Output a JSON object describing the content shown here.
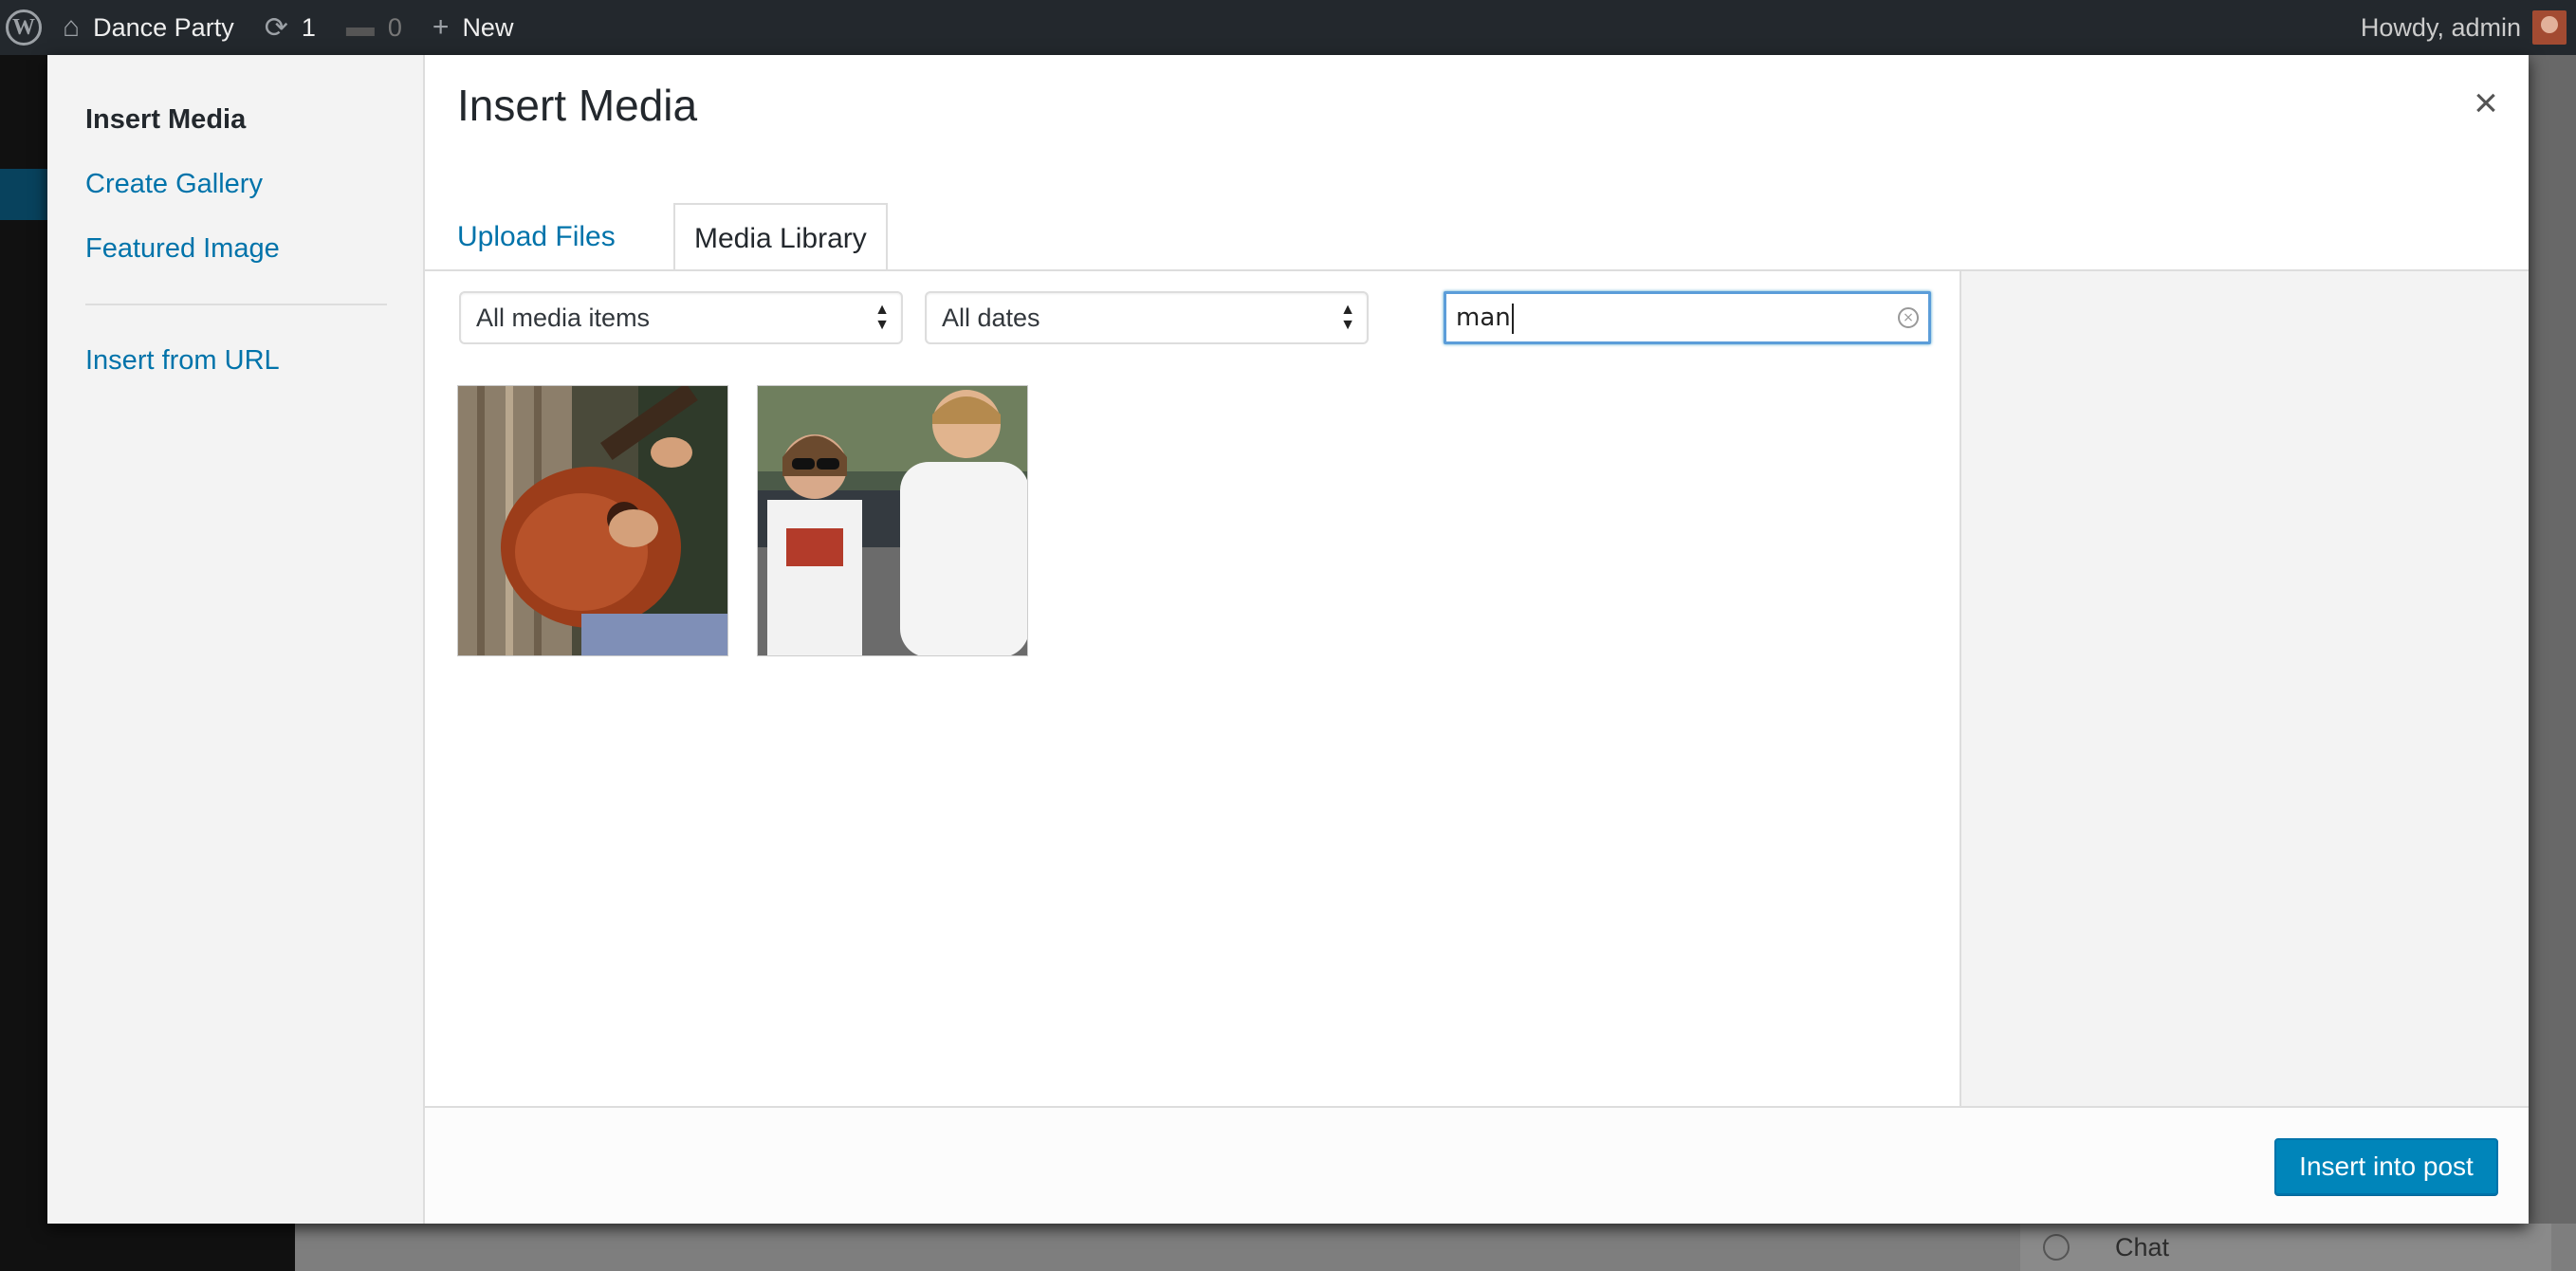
{
  "admin_bar": {
    "site_name": "Dance Party",
    "updates_count": "1",
    "comments_count": "0",
    "new_label": "New",
    "greeting": "Howdy, admin"
  },
  "background": {
    "chat_label": "Chat"
  },
  "modal": {
    "menu": {
      "insert_media": "Insert Media",
      "create_gallery": "Create Gallery",
      "featured_image": "Featured Image",
      "insert_from_url": "Insert from URL"
    },
    "title": "Insert Media",
    "close_glyph": "×",
    "tabs": [
      {
        "label": "Upload Files",
        "active": false
      },
      {
        "label": "Media Library",
        "active": true
      }
    ],
    "filters": {
      "media_type": "All media items",
      "dates": "All dates"
    },
    "search": {
      "value": "man"
    },
    "attachments": [
      {
        "icon": "guitar-photo-thumbnail"
      },
      {
        "icon": "people-talking-photo-thumbnail"
      }
    ],
    "insert_button": "Insert into post"
  },
  "colors": {
    "admin_bar": "#23282d",
    "link": "#0073aa",
    "primary_button": "#0085ba",
    "focus_border": "#5b9dd9"
  }
}
